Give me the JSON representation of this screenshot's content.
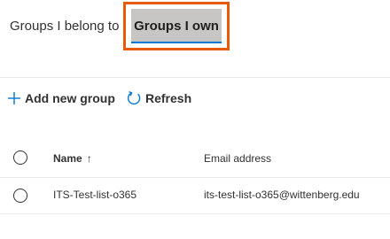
{
  "tabs": {
    "belong_label": "Groups I belong to",
    "own_label": "Groups I own"
  },
  "toolbar": {
    "add_label": "Add new group",
    "refresh_label": "Refresh"
  },
  "table": {
    "columns": [
      "Name",
      "Email address"
    ],
    "sort_indicator": "↑",
    "rows": [
      {
        "name": "ITS-Test-list-o365",
        "email": "its-test-list-o365@wittenberg.edu"
      }
    ]
  },
  "colors": {
    "highlight_border": "#e8590c",
    "active_tab_bg": "#c8c6c4",
    "accent": "#0078d4"
  },
  "icons": {
    "add": "plus-icon",
    "refresh": "refresh-icon",
    "sort": "arrow-up-icon"
  }
}
